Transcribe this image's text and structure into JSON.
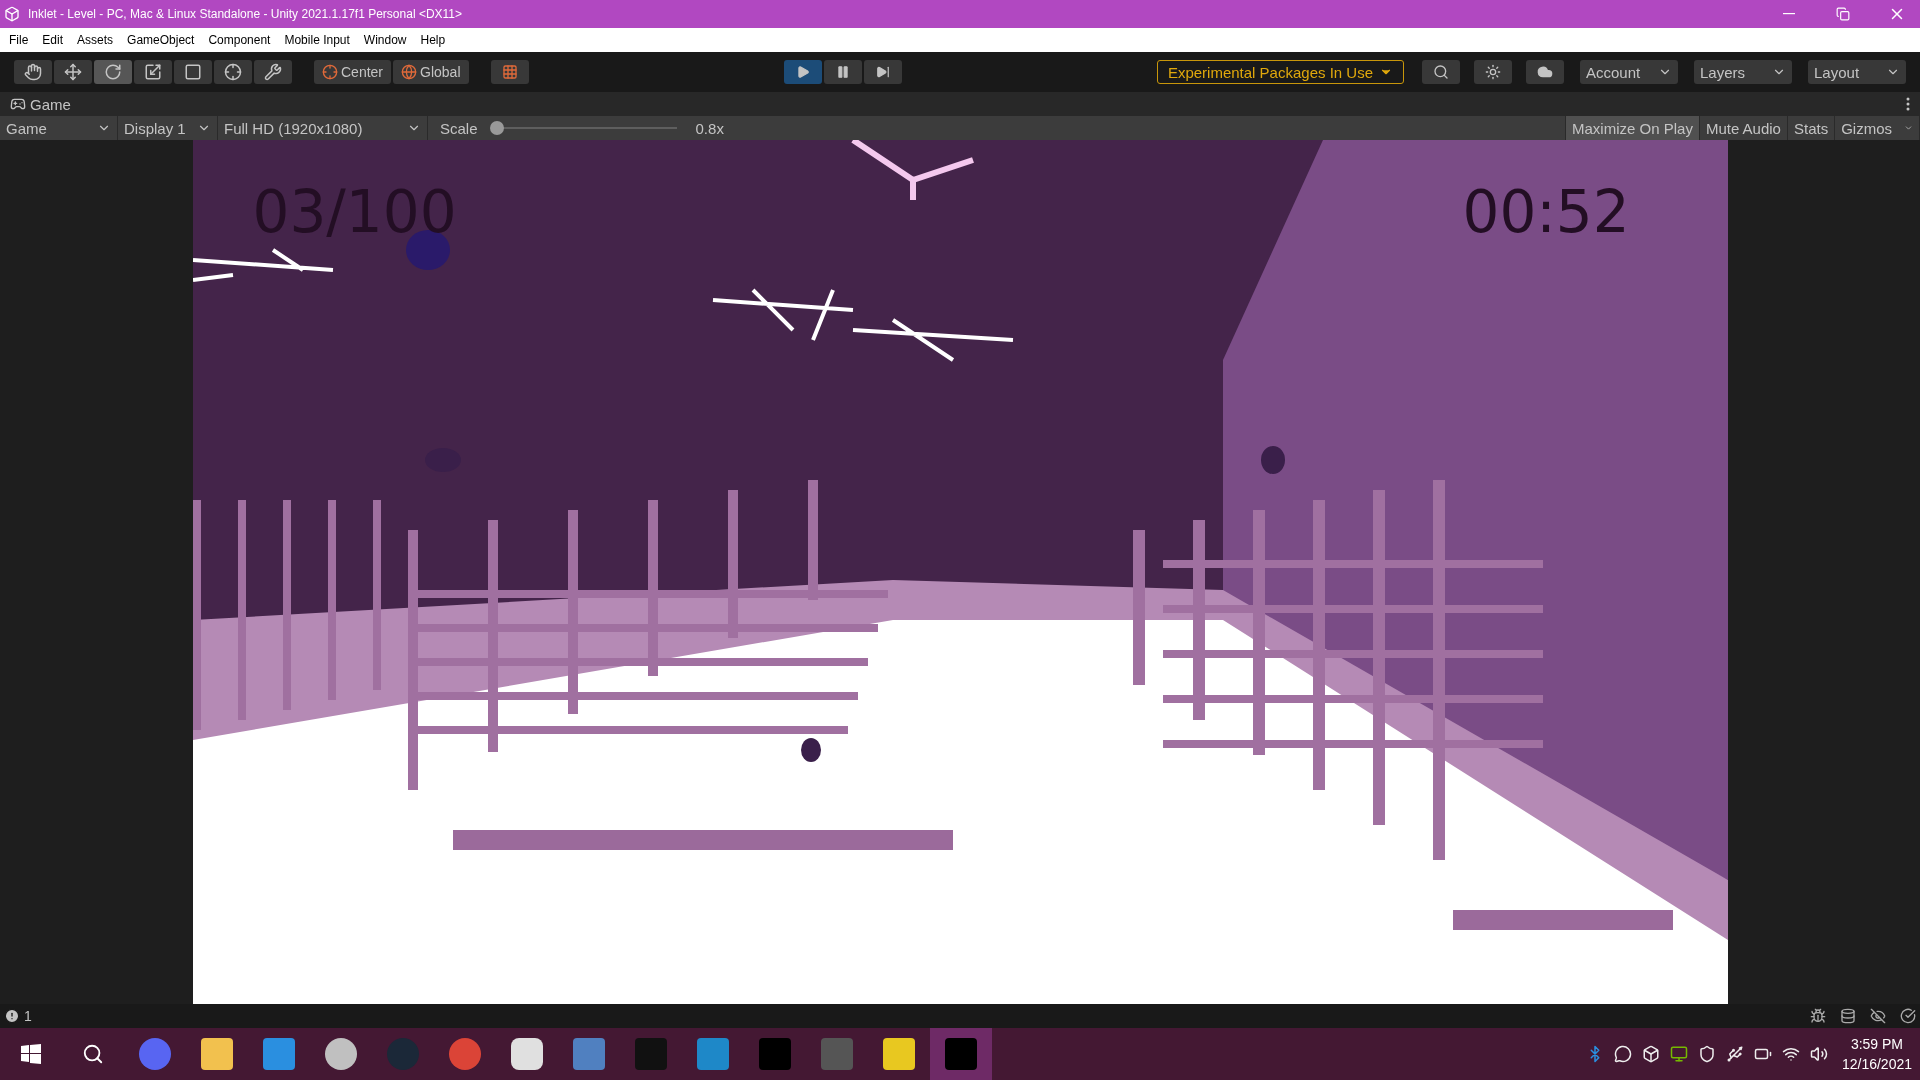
{
  "window": {
    "title": "Inklet - Level - PC, Mac & Linux Standalone - Unity 2021.1.17f1 Personal <DX11>"
  },
  "menu": [
    "File",
    "Edit",
    "Assets",
    "GameObject",
    "Component",
    "Mobile Input",
    "Window",
    "Help"
  ],
  "tools": [
    {
      "kind": "hand",
      "selected": false
    },
    {
      "kind": "move",
      "selected": false
    },
    {
      "kind": "rotate",
      "selected": true
    },
    {
      "kind": "scale",
      "selected": false
    },
    {
      "kind": "rect",
      "selected": false
    },
    {
      "kind": "transform",
      "selected": false
    },
    {
      "kind": "custom",
      "selected": false
    }
  ],
  "pivot_buttons": [
    {
      "kind": "center",
      "label": "Center"
    },
    {
      "kind": "global",
      "label": "Global"
    }
  ],
  "play_controls": [
    {
      "kind": "play",
      "selected": true
    },
    {
      "kind": "pause",
      "selected": false
    },
    {
      "kind": "step",
      "selected": false
    }
  ],
  "experimental": {
    "label": "Experimental Packages In Use"
  },
  "dropdowns": [
    "Account",
    "Layers",
    "Layout"
  ],
  "game_tab": {
    "label": "Game"
  },
  "game_toolbar": {
    "selects": [
      "Game",
      "Display 1",
      "Full HD (1920x1080)"
    ],
    "scale": {
      "label": "Scale",
      "level": 0.0,
      "reading": "0.8x"
    },
    "toggles": [
      {
        "label": "Maximize On Play",
        "selected": true
      },
      {
        "label": "Mute Audio",
        "selected": false
      },
      {
        "label": "Stats",
        "selected": false
      },
      {
        "label": "Gizmos",
        "selected": false
      }
    ]
  },
  "hud": {
    "score": "03/100",
    "timer": "00:52"
  },
  "status_bar": {
    "count": "1"
  },
  "taskbar": {
    "time": "3:59 PM",
    "date": "12/16/2021"
  }
}
